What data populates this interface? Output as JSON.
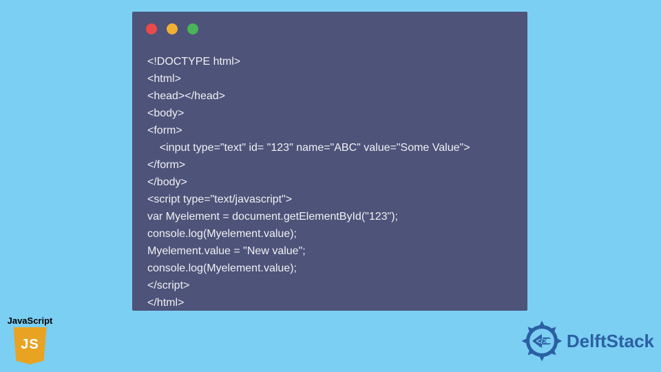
{
  "window": {
    "dots": {
      "red": "#ea4a49",
      "yellow": "#f0b133",
      "green": "#48b558"
    }
  },
  "code": {
    "lines": [
      "<!DOCTYPE html>",
      "<html>",
      "<head></head>",
      "<body>",
      "<form>",
      "    <input type=\"text\" id= \"123\" name=\"ABC\" value=\"Some Value\">",
      "</form>",
      "</body>",
      "<script type=\"text/javascript\">",
      "var Myelement = document.getElementById(\"123\");",
      "console.log(Myelement.value);",
      "Myelement.value = \"New value\";",
      "console.log(Myelement.value);",
      "</script>",
      "</html>"
    ]
  },
  "badges": {
    "js_label": "JavaScript",
    "js_logo_text": "JS",
    "delftstack": "DelftStack"
  },
  "colors": {
    "page_bg": "#7bcff3",
    "window_bg": "#4d5379",
    "code_fg": "#f1f1f3",
    "js_logo_bg": "#e8a323",
    "delftstack_text": "#2b5fa3"
  }
}
